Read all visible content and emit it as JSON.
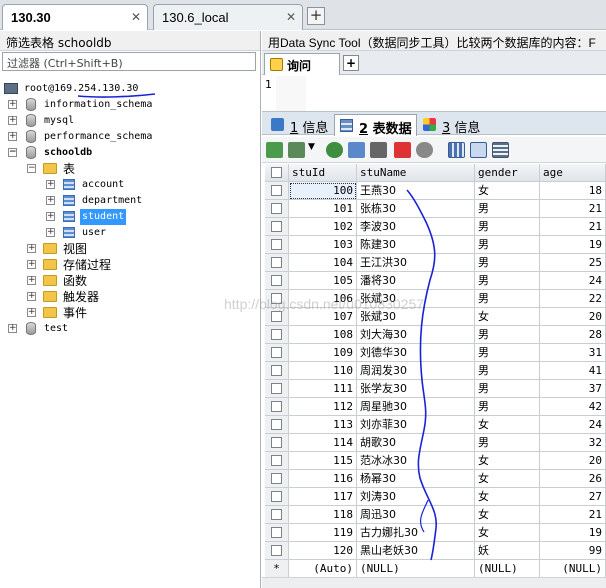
{
  "connection_tabs": [
    {
      "label": "130.30",
      "active": true
    },
    {
      "label": "130.6_local",
      "active": false
    }
  ],
  "left_panel": {
    "filter_header": "筛选表格 schooldb",
    "filter_placeholder": "过滤器 (Ctrl+Shift+B)",
    "server": "root@169.254.130.30",
    "databases": [
      {
        "name": "information_schema",
        "expanded": false
      },
      {
        "name": "mysql",
        "expanded": false
      },
      {
        "name": "performance_schema",
        "expanded": false
      },
      {
        "name": "schooldb",
        "expanded": true
      },
      {
        "name": "test",
        "expanded": false
      }
    ],
    "schooldb_folders": [
      "表",
      "视图",
      "存储过程",
      "函数",
      "触发器",
      "事件"
    ],
    "tables": [
      "account",
      "department",
      "student",
      "user"
    ],
    "selected_table": "student"
  },
  "right_panel": {
    "title": "用Data Sync Tool（数据同步工具）比较两个数据库的内容：F",
    "query_tab": "询问",
    "editor_line": "1",
    "result_tabs": [
      {
        "num": "1",
        "label": "信息",
        "active": false
      },
      {
        "num": "2",
        "label": "表数据",
        "active": true
      },
      {
        "num": "3",
        "label": "信息",
        "active": false
      }
    ],
    "toolbar_icons": [
      "grid-refresh-icon",
      "export-icon",
      "add-row-icon",
      "duplicate-row-icon",
      "save-icon",
      "delete-icon",
      "cancel-icon",
      "grid-view-icon",
      "form-view-icon",
      "text-view-icon"
    ]
  },
  "grid": {
    "columns": [
      "stuId",
      "stuName",
      "gender",
      "age"
    ],
    "rows": [
      [
        "100",
        "王燕30",
        "女",
        "18"
      ],
      [
        "101",
        "张栋30",
        "男",
        "21"
      ],
      [
        "102",
        "李波30",
        "男",
        "21"
      ],
      [
        "103",
        "陈建30",
        "男",
        "19"
      ],
      [
        "104",
        "王江洪30",
        "男",
        "25"
      ],
      [
        "105",
        "潘将30",
        "男",
        "24"
      ],
      [
        "106",
        "张斌30",
        "男",
        "22"
      ],
      [
        "107",
        "张斌30",
        "女",
        "20"
      ],
      [
        "108",
        "刘大海30",
        "男",
        "28"
      ],
      [
        "109",
        "刘德华30",
        "男",
        "31"
      ],
      [
        "110",
        "周润发30",
        "男",
        "41"
      ],
      [
        "111",
        "张学友30",
        "男",
        "37"
      ],
      [
        "112",
        "周星驰30",
        "男",
        "42"
      ],
      [
        "113",
        "刘亦菲30",
        "女",
        "24"
      ],
      [
        "114",
        "胡歌30",
        "男",
        "32"
      ],
      [
        "115",
        "范冰冰30",
        "女",
        "20"
      ],
      [
        "116",
        "杨幂30",
        "女",
        "26"
      ],
      [
        "117",
        "刘涛30",
        "女",
        "27"
      ],
      [
        "118",
        "周迅30",
        "女",
        "21"
      ],
      [
        "119",
        "古力娜扎30",
        "女",
        "19"
      ],
      [
        "120",
        "黑山老妖30",
        "妖",
        "99"
      ]
    ],
    "new_row": {
      "marker": "*",
      "stuId": "(Auto)",
      "stuName": "(NULL)",
      "gender": "(NULL)",
      "age": "(NULL)"
    }
  },
  "watermark": "http://blog.csdn.net/u010830257",
  "colors": {
    "accent": "#3399ff",
    "annotation": "#1a23d6"
  }
}
